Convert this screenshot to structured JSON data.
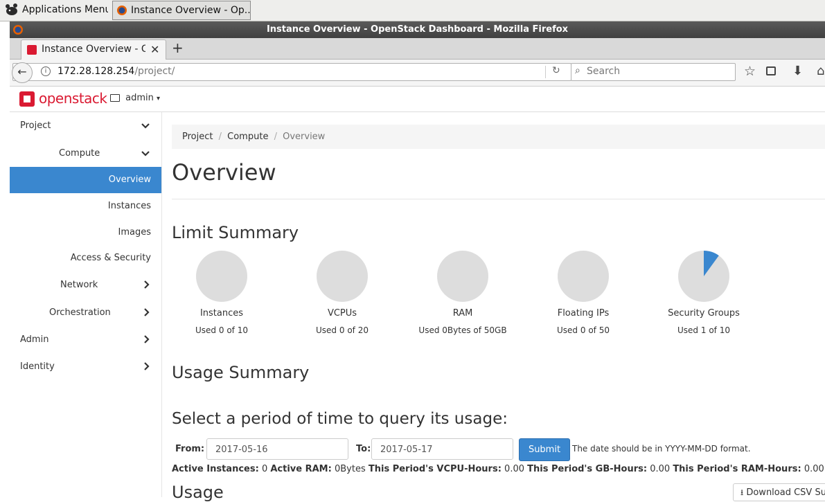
{
  "taskbar": {
    "apps_menu": "Applications Menu",
    "window_button": "Instance Overview - Op..."
  },
  "window": {
    "title": "Instance Overview - OpenStack Dashboard - Mozilla Firefox"
  },
  "browser": {
    "tab_label": "Instance Overview - Op",
    "url_host": "172.28.128.254",
    "url_path": "/project/",
    "search_placeholder": "Search"
  },
  "header": {
    "logo_text": "openstack",
    "project_selector": "admin"
  },
  "sidebar": {
    "project": "Project",
    "compute": "Compute",
    "items": [
      "Overview",
      "Instances",
      "Images",
      "Access & Security"
    ],
    "network": "Network",
    "orchestration": "Orchestration",
    "admin": "Admin",
    "identity": "Identity"
  },
  "breadcrumb": {
    "project": "Project",
    "compute": "Compute",
    "current": "Overview",
    "sep": "/"
  },
  "page_title": "Overview",
  "limit_summary": {
    "heading": "Limit Summary",
    "charts": [
      {
        "label": "Instances",
        "usage": "Used 0 of 10",
        "used": 0,
        "total": 10
      },
      {
        "label": "VCPUs",
        "usage": "Used 0 of 20",
        "used": 0,
        "total": 20
      },
      {
        "label": "RAM",
        "usage": "Used 0Bytes of 50GB",
        "used": 0,
        "total": 50
      },
      {
        "label": "Floating IPs",
        "usage": "Used 0 of 50",
        "used": 0,
        "total": 50
      },
      {
        "label": "Security Groups",
        "usage": "Used 1 of 10",
        "used": 1,
        "total": 10
      }
    ]
  },
  "usage_summary": {
    "heading": "Usage Summary",
    "query_heading": "Select a period of time to query its usage:",
    "from_label": "From:",
    "from_value": "2017-05-16",
    "to_label": "To:",
    "to_value": "2017-05-17",
    "submit": "Submit",
    "hint": "The date should be in YYYY-MM-DD format.",
    "stats": {
      "active_instances_label": "Active Instances:",
      "active_instances": "0",
      "active_ram_label": "Active RAM:",
      "active_ram": "0Bytes",
      "vcpu_hours_label": "This Period's VCPU-Hours:",
      "vcpu_hours": "0.00",
      "gb_hours_label": "This Period's GB-Hours:",
      "gb_hours": "0.00",
      "ram_hours_label": "This Period's RAM-Hours:",
      "ram_hours": "0.00"
    },
    "usage_heading": "Usage",
    "download_csv": "Download CSV Summary"
  },
  "colors": {
    "accent": "#3a87cf",
    "pie_empty": "#dddddd",
    "brand_red": "#da1a32"
  }
}
